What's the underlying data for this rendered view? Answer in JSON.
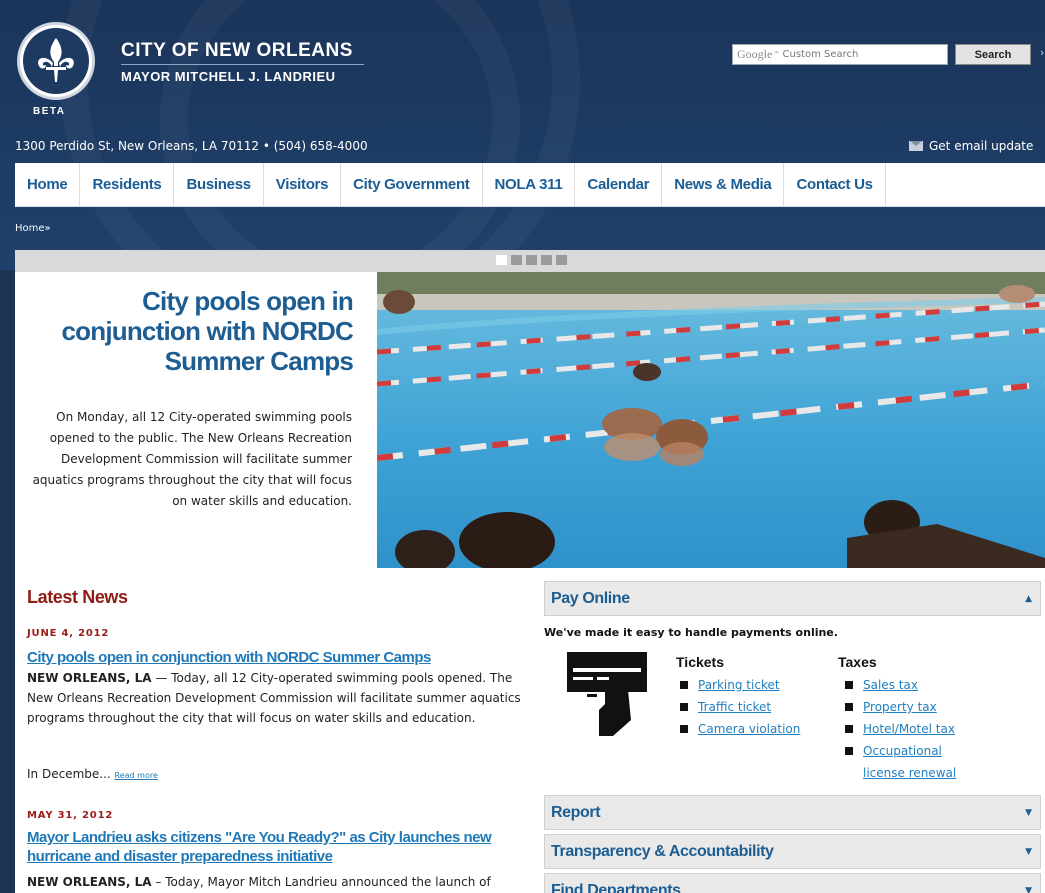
{
  "header": {
    "seal_label": "BETA",
    "title": "CITY OF NEW ORLEANS",
    "subtitle": "MAYOR MITCHELL J. LANDRIEU",
    "address": "1300 Perdido St, New Orleans, LA 70112 • (504) 658-4000",
    "email_updates": "Get email update",
    "search": {
      "placeholder_google": "Google",
      "placeholder_text": "Custom Search",
      "button": "Search"
    }
  },
  "nav": {
    "items": [
      "Home",
      "Residents",
      "Business",
      "Visitors",
      "City Government",
      "NOLA 311",
      "Calendar",
      "News & Media",
      "Contact Us"
    ]
  },
  "breadcrumb": "Home»",
  "slider": {
    "dots": 5,
    "active": 0
  },
  "hero": {
    "title": "City pools open in conjunction with NORDC Summer Camps",
    "text": "On Monday, all 12 City-operated swimming pools opened to the public. The New Orleans Recreation Development Commission will facilitate summer aquatics programs throughout the city that will focus on water skills and education."
  },
  "latest_news": {
    "heading": "Latest News",
    "items": [
      {
        "date": "JUNE 4, 2012",
        "title": "City pools open in conjunction with NORDC Summer Camps",
        "lead": "NEW ORLEANS, LA",
        "body": " — Today, all 12 City-operated swimming pools opened. The New Orleans Recreation Development Commission will facilitate summer aquatics programs throughout the city that will focus on water skills and education.",
        "teaser": "In Decembe...",
        "read_more": "Read more"
      },
      {
        "date": "MAY 31, 2012",
        "title": "Mayor Landrieu asks citizens \"Are You Ready?\" as City launches new hurricane and disaster preparedness initiative",
        "lead": "NEW ORLEANS, LA",
        "body": " – Today, Mayor Mitch Landrieu announced the launch of"
      }
    ]
  },
  "pay_online": {
    "heading": "Pay Online",
    "intro": "We've made it easy to handle payments online.",
    "tickets": {
      "heading": "Tickets",
      "items": [
        "Parking ticket",
        "Traffic ticket",
        "Camera violation"
      ]
    },
    "taxes": {
      "heading": "Taxes",
      "items": [
        "Sales tax",
        "Property tax",
        "Hotel/Motel tax",
        "Occupational license renewal"
      ]
    }
  },
  "accordion": [
    "Report",
    "Transparency & Accountability",
    "Find Departments"
  ],
  "colors": {
    "header_bg": "#1d3a62",
    "nav_text": "#1b5d95",
    "news_red": "#8e1c15",
    "link_blue": "#1f78b7"
  }
}
